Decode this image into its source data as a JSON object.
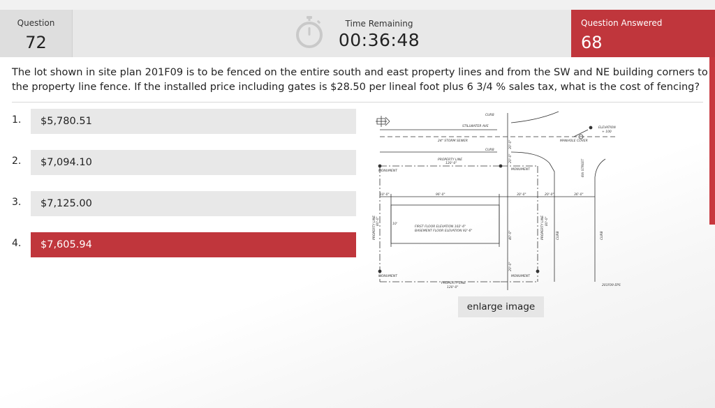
{
  "header": {
    "question_label": "Question",
    "question_number": "72",
    "time_label": "Time Remaining",
    "time_value": "00:36:48",
    "answered_label": "Question Answered",
    "answered_count": "68"
  },
  "question": {
    "text": "The lot shown in site plan 201F09 is to be fenced on the entire south and east property lines and from the SW and NE building corners to the property line fence. If the installed price including gates is $28.50 per lineal foot plus 6 3/4 % sales tax, what is the cost of fencing?"
  },
  "answers": [
    {
      "number": "1.",
      "value": "$5,780.51",
      "selected": false
    },
    {
      "number": "2.",
      "value": "$7,094.10",
      "selected": false
    },
    {
      "number": "3.",
      "value": "$7,125.00",
      "selected": false
    },
    {
      "number": "4.",
      "value": "$7,605.94",
      "selected": true
    }
  ],
  "site_plan": {
    "curb_top": "CURB",
    "stillwater": "STILLWATER AVE",
    "storm_sewer": "24\" STORM SEWER",
    "manhole": "MANHOLE COVER",
    "elevation": "ELEVATION",
    "elevation_val": "+ 100",
    "curb_mid": "CURB",
    "property_line_top": "PROPERTY LINE",
    "property_dim_top": "120'-0\"",
    "monument_tl": "MONUMENT",
    "monument_tr": "MONUMENT",
    "monument_bl": "MONUMENT",
    "monument_br": "MONUMENT",
    "dim_left": "10'-0\"",
    "dim_building": "96'-0\"",
    "dim_right": "30'-0\"",
    "dim_street": "20'-0\"",
    "dim_far": "36'-0\"",
    "dim_30": "30'-0\"",
    "dim_20a": "20'-0\"",
    "dim_40": "40'-0\"",
    "dim_20b": "20'-0\"",
    "dim_10": "10'",
    "first_floor": "FIRST FLOOR ELEVATION 102'-6\"",
    "basement": "BASEMENT FLOOR ELEVATION 92'-6\"",
    "property_line_left": "PROPERTY LINE",
    "property_dim_left": "80'-0\"",
    "property_line_right": "PROPERTY LINE",
    "property_dim_right": "80'-0\"",
    "curb_right": "CURB",
    "curb_far": "CURB",
    "street": "6th STREET",
    "property_line_bottom": "PROPERTY LINE",
    "property_dim_bottom": "120'-0\"",
    "plan_id": "201F09 EPS",
    "enlarge_label": "enlarge image"
  },
  "colors": {
    "accent_red": "#c0363c",
    "header_gray": "#e8e8e8",
    "answer_gray": "#e8e8e8"
  },
  "icons": {
    "timer": "stopwatch-icon",
    "north_arrow": "north-arrow-icon"
  }
}
